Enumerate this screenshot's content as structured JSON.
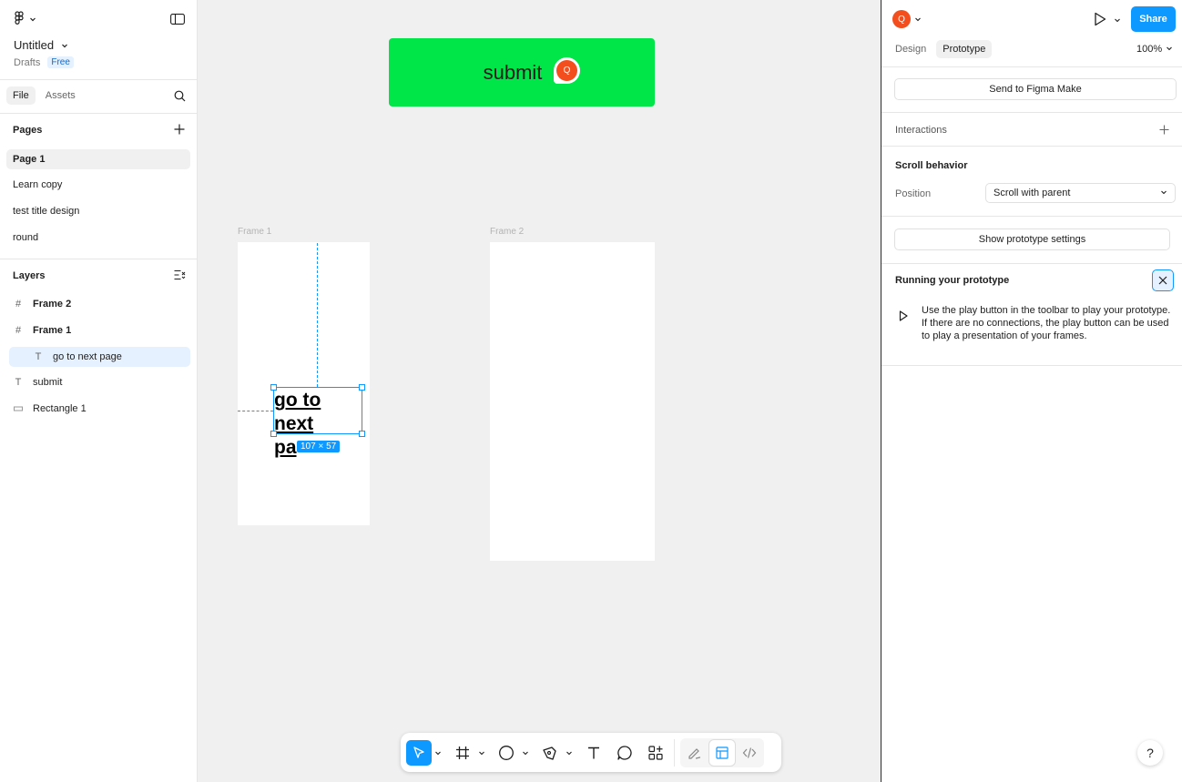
{
  "left_panel": {
    "file_title": "Untitled",
    "drafts_label": "Drafts",
    "plan_badge": "Free",
    "tabs": [
      {
        "label": "File"
      },
      {
        "label": "Assets"
      }
    ],
    "pages_title": "Pages",
    "pages": [
      {
        "label": "Page 1"
      },
      {
        "label": "Learn copy"
      },
      {
        "label": "test  title design"
      },
      {
        "label": "round"
      }
    ],
    "layers_title": "Layers",
    "layers": [
      {
        "label": "Frame 2",
        "icon": "frame-icon"
      },
      {
        "label": "Frame 1",
        "icon": "frame-icon"
      },
      {
        "label": "go to next page",
        "icon": "text-icon"
      },
      {
        "label": "submit",
        "icon": "text-icon"
      },
      {
        "label": "Rectangle 1",
        "icon": "rectangle-icon"
      }
    ]
  },
  "canvas": {
    "submit_label": "submit",
    "avatar_initial": "Q",
    "frame1_label": "Frame 1",
    "frame2_label": "Frame 2",
    "text_line1": "go to",
    "text_line2": "next",
    "text_line3": "pa",
    "dimensions": "107 × 57"
  },
  "right_panel": {
    "avatar_initial": "Q",
    "share_label": "Share",
    "tabs": [
      {
        "label": "Design"
      },
      {
        "label": "Prototype"
      }
    ],
    "zoom": "100%",
    "send_button": "Send to Figma Make",
    "interactions_title": "Interactions",
    "scroll_title": "Scroll behavior",
    "position_label": "Position",
    "position_value": "Scroll with parent",
    "show_settings_button": "Show prototype settings",
    "running_title": "Running your prototype",
    "running_text": "Use the play button in the toolbar to play your prototype. If there are no connections, the play button can be used to play a presentation of your frames."
  },
  "colors": {
    "accent": "#0d99ff",
    "submit_fill": "#00e547",
    "avatar": "#f24e1e"
  }
}
